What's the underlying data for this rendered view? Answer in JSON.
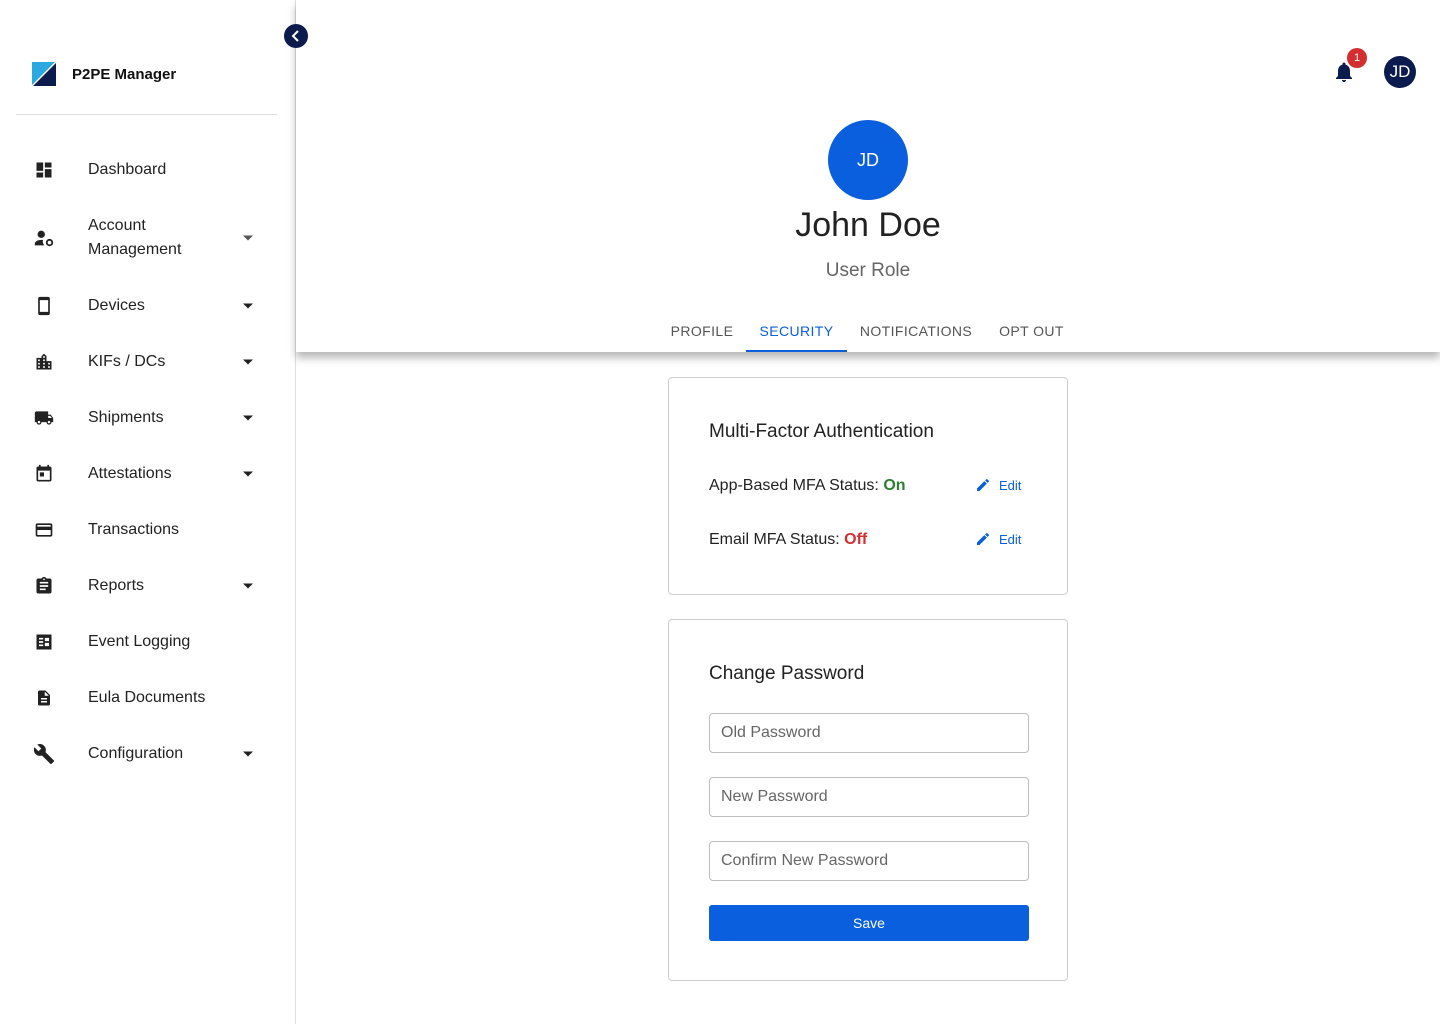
{
  "app": {
    "name": "P2PE Manager"
  },
  "sidebar": {
    "items": [
      {
        "label": "Dashboard",
        "icon": "dashboard-icon",
        "expandable": false
      },
      {
        "label": "Account Management",
        "icon": "account-management-icon",
        "expandable": true
      },
      {
        "label": "Devices",
        "icon": "phone-icon",
        "expandable": true
      },
      {
        "label": "KIFs / DCs",
        "icon": "building-icon",
        "expandable": true
      },
      {
        "label": "Shipments",
        "icon": "truck-icon",
        "expandable": true
      },
      {
        "label": "Attestations",
        "icon": "calendar-icon",
        "expandable": true
      },
      {
        "label": "Transactions",
        "icon": "credit-card-icon",
        "expandable": false
      },
      {
        "label": "Reports",
        "icon": "clipboard-icon",
        "expandable": true
      },
      {
        "label": "Event Logging",
        "icon": "list-icon",
        "expandable": false
      },
      {
        "label": "Eula Documents",
        "icon": "document-icon",
        "expandable": false
      },
      {
        "label": "Configuration",
        "icon": "wrench-icon",
        "expandable": true
      }
    ]
  },
  "header": {
    "notification_count": "1",
    "avatar_initials": "JD"
  },
  "profile": {
    "initials": "JD",
    "name": "John Doe",
    "role": "User Role"
  },
  "tabs": [
    {
      "label": "PROFILE",
      "active": false
    },
    {
      "label": "SECURITY",
      "active": true
    },
    {
      "label": "NOTIFICATIONS",
      "active": false
    },
    {
      "label": "OPT OUT",
      "active": false
    }
  ],
  "mfa": {
    "title": "Multi-Factor Authentication",
    "app_label": "App-Based MFA Status: ",
    "app_status": "On",
    "email_label": "Email MFA Status: ",
    "email_status": "Off",
    "edit_label": "Edit"
  },
  "password": {
    "title": "Change Password",
    "old_placeholder": "Old Password",
    "new_placeholder": "New Password",
    "confirm_placeholder": "Confirm New Password",
    "save_label": "Save"
  },
  "colors": {
    "primary": "#0a5fde",
    "navy": "#0c1b4d",
    "success": "#2e7d32",
    "danger": "#d32f2f"
  }
}
